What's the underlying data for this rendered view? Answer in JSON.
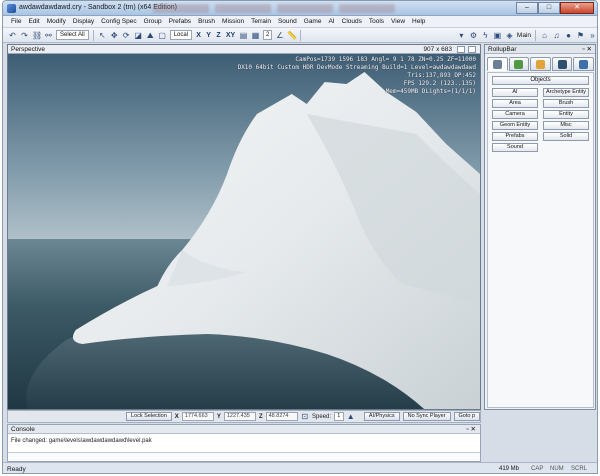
{
  "window": {
    "title": "awdawdawdawd.cry - Sandbox 2 (tm) (x64 Edition)",
    "min": "–",
    "max": "□",
    "close": "✕"
  },
  "menu": [
    "File",
    "Edit",
    "Modify",
    "Display",
    "Config Spec",
    "Group",
    "Prefabs",
    "Brush",
    "Mission",
    "Terrain",
    "Sound",
    "Game",
    "AI",
    "Clouds",
    "Tools",
    "View",
    "Help"
  ],
  "toolbar": {
    "selection": "Select All",
    "coord_system": "Local",
    "axes": [
      "X",
      "Y",
      "Z",
      "XY"
    ],
    "snap_value": "2",
    "main_label": "Main"
  },
  "viewport": {
    "title": "Perspective",
    "resolution": "907 x 683",
    "hud_lines": [
      "CamPos=1739 1596 183 Angl=  9  1 78 ZN=0.25 ZF=11000",
      "DX10 64bit Custom HDR DevMode Streaming Build=1 Level=awdawdawdawd",
      "Tris:137,893  DP:452",
      "FPS 129.2 (123..135)",
      "Mem=459MB DLights=(1/1/1)"
    ],
    "colors": {
      "sky_top": "#3e5e75",
      "sky_horizon": "#b9c8d0",
      "water": "#2d4753",
      "snow": "#eef1f2"
    }
  },
  "viewport_status": {
    "lock_selection": "Lock Selection",
    "x_label": "X",
    "x_value": "1774.663",
    "y_label": "Y",
    "y_value": "1227.435",
    "z_label": "Z",
    "z_value": "48.8274",
    "speed_label": "Speed:",
    "speed_value": "1",
    "ai_physics": "AI/Physics",
    "no_sync_player": "No Sync Player",
    "goto_pos": "Goto p"
  },
  "console": {
    "title": "Console",
    "pins": "▫ ✕",
    "message": "File changed: game\\levels\\awdawdawdawd\\level.pak"
  },
  "statusbar": {
    "ready": "Ready",
    "memory": "419 Mb",
    "keys": [
      "CAP",
      "NUM",
      "SCRL"
    ]
  },
  "rollup": {
    "title": "RollupBar",
    "pins": "▫ ✕",
    "tabs": [
      {
        "name": "objects-tab-icon",
        "color": "#6b7f99"
      },
      {
        "name": "terrain-tab-icon",
        "color": "#4f9a43"
      },
      {
        "name": "modify-tab-icon",
        "color": "#e1a43a"
      },
      {
        "name": "display-tab-icon",
        "color": "#2f4f6f"
      },
      {
        "name": "layers-tab-icon",
        "color": "#3e6fa8"
      }
    ],
    "objects_header": "Objects",
    "buttons": [
      "AI",
      "Archetype Entity",
      "Area",
      "Brush",
      "Camera",
      "Entity",
      "Geom Entity",
      "Misc",
      "Prefabs",
      "Solid",
      "Sound"
    ]
  }
}
